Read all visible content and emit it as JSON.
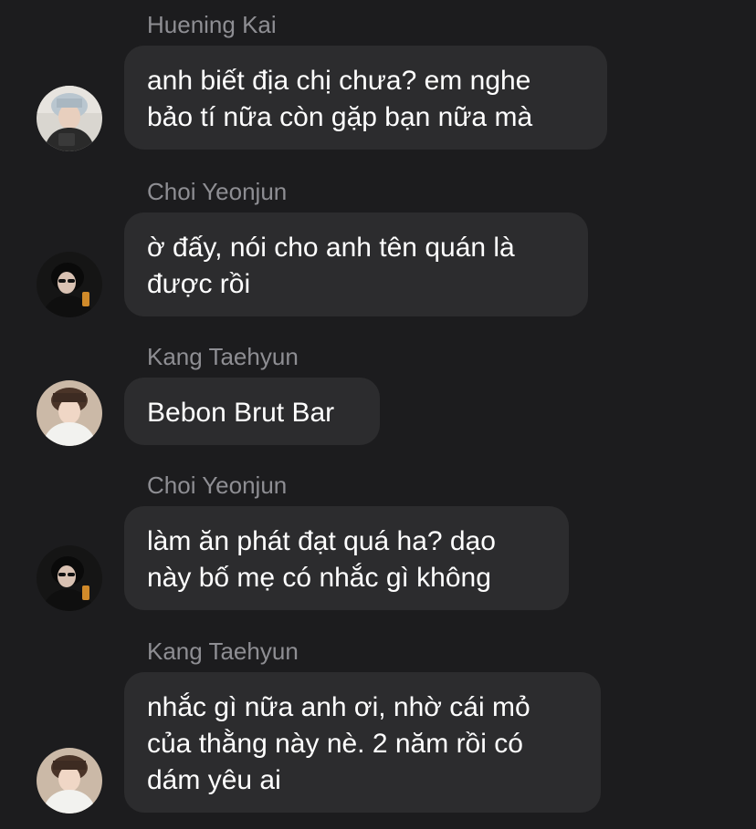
{
  "messages": [
    {
      "sender": "Huening Kai",
      "text": "anh biết địa chị chưa? em nghe\nbảo tí nữa còn gặp bạn nữa mà",
      "avatar": "huening-kai-avatar"
    },
    {
      "sender": "Choi Yeonjun",
      "text": "ờ đấy, nói cho anh tên quán là\nđược rồi",
      "avatar": "choi-yeonjun-avatar"
    },
    {
      "sender": "Kang Taehyun",
      "text": "Bebon Brut Bar",
      "avatar": "kang-taehyun-avatar"
    },
    {
      "sender": "Choi Yeonjun",
      "text": "làm ăn phát đạt quá ha? dạo\nnày bố mẹ có nhắc gì không",
      "avatar": "choi-yeonjun-avatar"
    },
    {
      "sender": "Kang Taehyun",
      "text": "nhắc gì nữa anh ơi, nhờ cái mỏ\ncủa thằng này nè. 2 năm rồi có\ndám yêu ai",
      "avatar": "kang-taehyun-avatar"
    }
  ],
  "colors": {
    "background": "#1c1c1e",
    "bubble": "#2c2c2e",
    "sender_text": "#8e8e93",
    "message_text": "#ffffff"
  }
}
